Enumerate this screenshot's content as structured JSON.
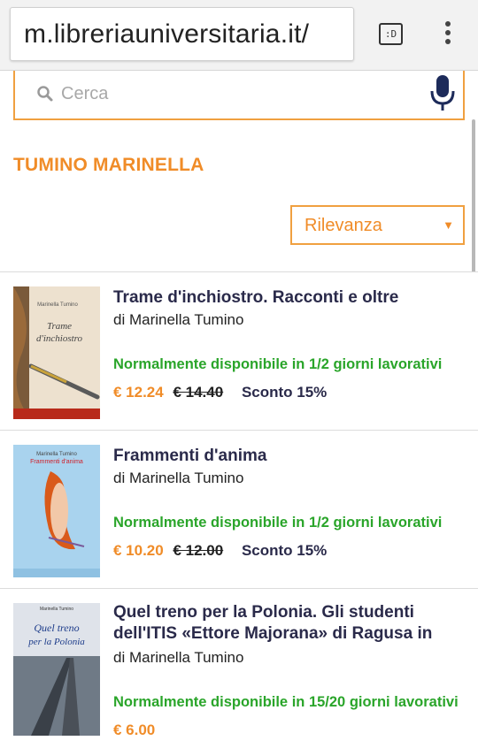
{
  "browser": {
    "url": "m.libreriauniversitaria.it/",
    "tab_label": ":D"
  },
  "search": {
    "placeholder": "Cerca"
  },
  "page": {
    "title": "TUMINO MARINELLA"
  },
  "sort": {
    "selected": "Rilevanza",
    "arrow": "▼"
  },
  "colors": {
    "accent_orange": "#f08c28",
    "available_green": "#2aa52a",
    "title_navy": "#2a2a4a"
  },
  "products": [
    {
      "title": "Trame d'inchiostro. Racconti e oltre",
      "author": "di Marinella Tumino",
      "availability": "Normalmente disponibile in 1/2 giorni lavorativi",
      "price": "€ 12.24",
      "old_price": "€ 14.40",
      "discount": "Sconto 15%",
      "cover": {
        "author_line": "Marinella Tumino",
        "title_line1": "Trame",
        "title_line2": "d'inchiostro"
      }
    },
    {
      "title": "Frammenti d'anima",
      "author": "di Marinella Tumino",
      "availability": "Normalmente disponibile in 1/2 giorni lavorativi",
      "price": "€ 10.20",
      "old_price": "€ 12.00",
      "discount": "Sconto 15%",
      "cover": {
        "author_line": "Marinella Tumino",
        "title_line1": "Frammenti d'anima"
      }
    },
    {
      "title": "Quel treno per la Polonia. Gli studenti dell'ITIS «Ettore Majorana» di Ragusa in",
      "author": "di Marinella Tumino",
      "availability": "Normalmente disponibile in 15/20 giorni lavorativi",
      "price": "€ 6.00",
      "cover": {
        "author_line": "Marinella Tumino",
        "title_line1": "Quel treno",
        "title_line2": "per la Polonia"
      }
    }
  ]
}
